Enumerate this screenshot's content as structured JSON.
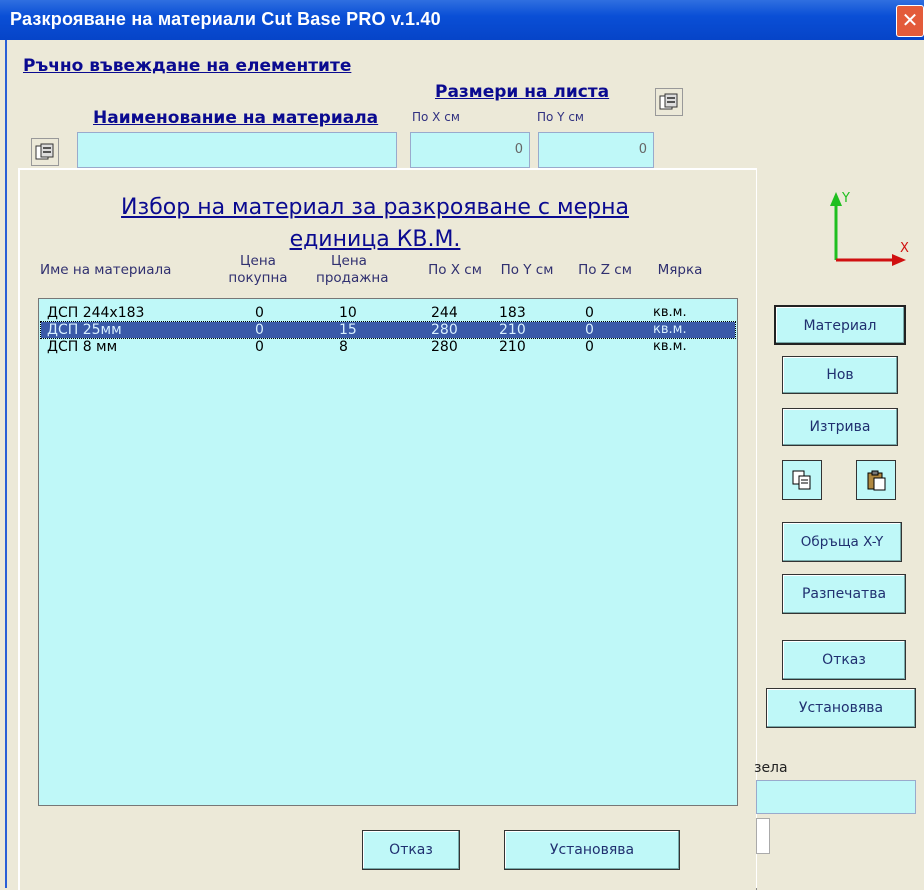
{
  "window": {
    "title": "Разкрояване на материали Cut Base PRO v.1.40",
    "close_glyph": "✕"
  },
  "header": {
    "manual_entry_label": "Ръчно въвеждане на елементите",
    "material_name_label": "Наименование на материала",
    "sheet_size_label": "Размери на листа",
    "x_label": "По X см",
    "y_label": "По Y см",
    "material_name_value": "",
    "x_value": "0",
    "y_value": "0"
  },
  "panel": {
    "title": "Избор на материал за разкрояване с мерна единица КВ.М.",
    "columns": {
      "name": "Име на материала",
      "buy": "Цена покупна",
      "sell": "Цена продажна",
      "x": "По X см",
      "y": "По Y см",
      "z": "По Z см",
      "unit": "Мярка"
    },
    "rows": [
      {
        "name": "ДСП 244х183",
        "buy": "0",
        "sell": "10",
        "x": "244",
        "y": "183",
        "z": "0",
        "unit": "кв.м."
      },
      {
        "name": "ДСП 25мм",
        "buy": "0",
        "sell": "15",
        "x": "280",
        "y": "210",
        "z": "0",
        "unit": "кв.м."
      },
      {
        "name": "ДСП 8 мм",
        "buy": "0",
        "sell": "8",
        "x": "280",
        "y": "210",
        "z": "0",
        "unit": "кв.м."
      }
    ],
    "selected_row": 1,
    "cancel_label": "Отказ",
    "set_label": "Установява"
  },
  "side": {
    "material_label": "Материал",
    "new_label": "Нов",
    "delete_label": "Изтрива",
    "swap_label": "Обръща X-Y",
    "print_label": "Разпечатва",
    "cancel_label": "Отказ",
    "set_label": "Установява",
    "partial_label": "зела",
    "axis_y": "Y",
    "axis_x": "X"
  },
  "colors": {
    "titlebar": "#0a4fd6",
    "field": "#bff8f8",
    "selection": "#3a5aa8",
    "label": "#0a0a90"
  }
}
